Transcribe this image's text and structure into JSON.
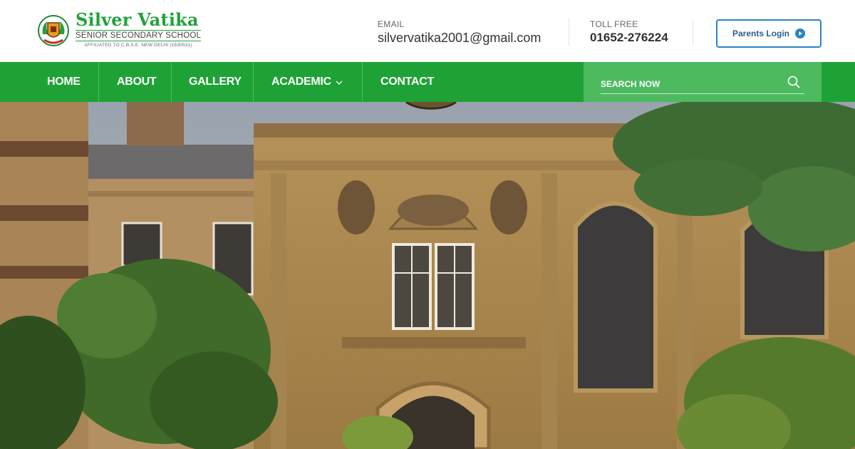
{
  "brand": {
    "name": "Silver Vatika",
    "subtitle": "SENIOR SECONDARY SCHOOL",
    "affiliation": "AFFILIATED TO C.B.S.E. NEW DELHI (1630531)"
  },
  "contact": {
    "email_label": "EMAIL",
    "email_value": "silvervatika2001@gmail.com",
    "phone_label": "TOLL FREE",
    "phone_value": "01652-276224"
  },
  "login": {
    "label": "Parents Login",
    "icon": "play-circle-icon"
  },
  "nav": {
    "items": [
      {
        "label": "HOME"
      },
      {
        "label": "ABOUT"
      },
      {
        "label": "GALLERY"
      },
      {
        "label": "ACADEMIC",
        "has_dropdown": true
      },
      {
        "label": "CONTACT"
      }
    ]
  },
  "search": {
    "placeholder": "SEARCH NOW",
    "icon": "search-icon"
  },
  "colors": {
    "brand_green": "#1ea236",
    "search_green": "#4dba60",
    "login_blue": "#2a83c6",
    "logo_green": "#21a33b"
  }
}
